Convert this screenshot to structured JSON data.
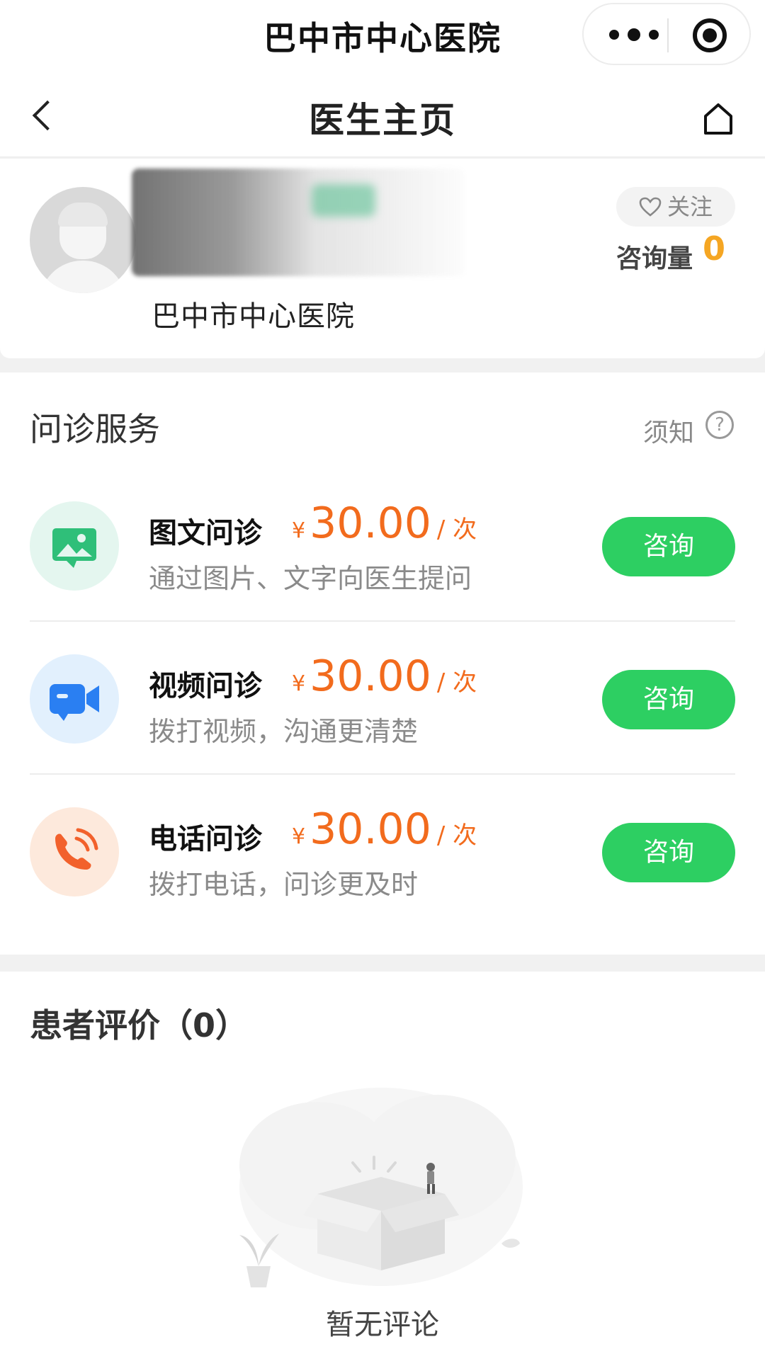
{
  "app": {
    "title": "巴中市中心医院"
  },
  "nav": {
    "title": "医生主页"
  },
  "doctor": {
    "hospital": "巴中市中心医院",
    "follow_label": "关注",
    "consult_count_label": "咨询量",
    "consult_count": "0"
  },
  "services": {
    "title": "问诊服务",
    "notice_label": "须知",
    "help_glyph": "?",
    "items": [
      {
        "name": "图文问诊",
        "currency": "¥",
        "price": "30.00",
        "unit": "/ 次",
        "desc": "通过图片、文字向医生提问",
        "button": "咨询",
        "icon": "image-text-icon",
        "color": "#2fbf79",
        "bg": "#e4f6ef"
      },
      {
        "name": "视频问诊",
        "currency": "¥",
        "price": "30.00",
        "unit": "/ 次",
        "desc": "拨打视频，沟通更清楚",
        "button": "咨询",
        "icon": "video-camera-icon",
        "color": "#2a7ff2",
        "bg": "#e2f0fd"
      },
      {
        "name": "电话问诊",
        "currency": "¥",
        "price": "30.00",
        "unit": "/ 次",
        "desc": "拨打电话，问诊更及时",
        "button": "咨询",
        "icon": "phone-icon",
        "color": "#f2612c",
        "bg": "#fde9dc"
      }
    ]
  },
  "reviews": {
    "title": "患者评价（0）",
    "empty_text": "暂无评论"
  },
  "colors": {
    "accent_green": "#2dcf62",
    "price_orange": "#f26b1d",
    "count_yellow": "#f5a623"
  }
}
